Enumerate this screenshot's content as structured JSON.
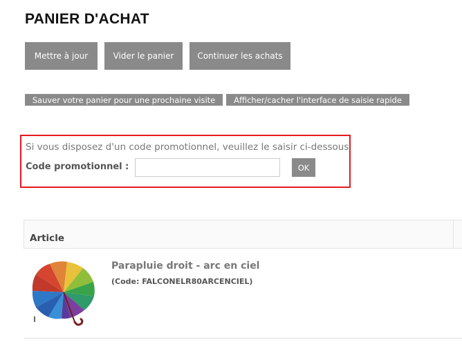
{
  "page": {
    "title": "PANIER D'ACHAT"
  },
  "actions": {
    "update": "Mettre à jour",
    "empty": "Vider le panier",
    "continue": "Continuer les achats",
    "save_cart": "Sauver votre panier pour une prochaine visite",
    "toggle_quick_entry": "Afficher/cacher l'interface de saisie rapide"
  },
  "promo": {
    "instructions": "Si vous disposez d'un code promotionnel, veuillez le saisir ci-dessous.",
    "label": "Code promotionnel :",
    "value": "",
    "submit_label": "OK"
  },
  "cart_table": {
    "columns": [
      "Article"
    ],
    "rows": [
      {
        "name": "Parapluie droit - arc en ciel",
        "code": "(Code: FALCONELR80ARCENCIEL)",
        "image": "rainbow-umbrella"
      }
    ]
  },
  "colors": {
    "button_bg": "#8a8a8a",
    "button_text": "#ffffff",
    "highlight_border": "#e6191d"
  }
}
